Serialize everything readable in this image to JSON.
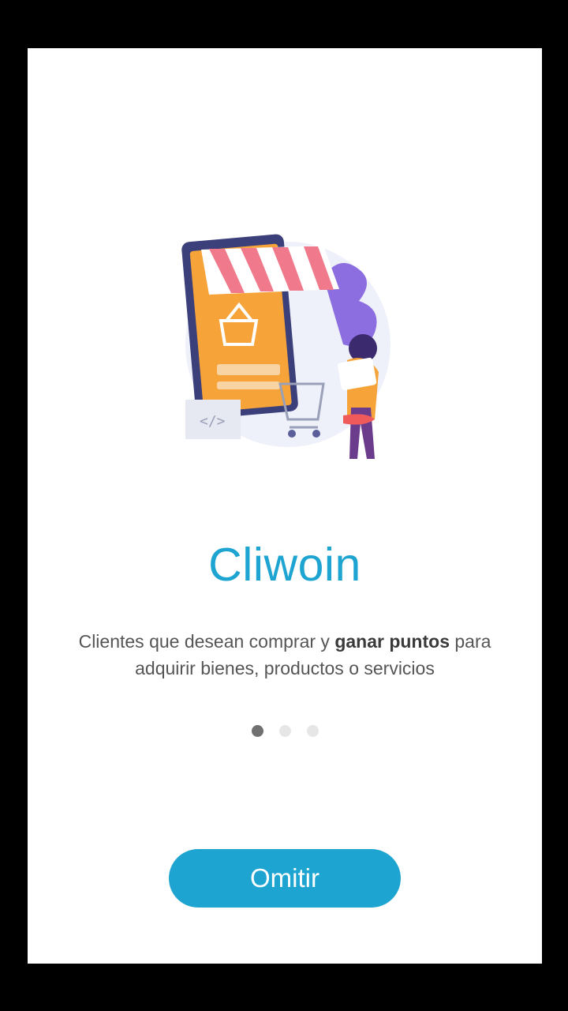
{
  "onboarding": {
    "illustration_icon": "shopping-cart-illustration",
    "title": "Cliwoin",
    "description_part1": "Clientes que desean comprar y ",
    "description_bold": "ganar puntos",
    "description_part2": " para adquirir bienes, productos o servicios",
    "pager": {
      "total": 3,
      "active_index": 0
    },
    "skip_label": "Omitir"
  },
  "colors": {
    "accent": "#1ea4d1",
    "dot_active": "#707070",
    "dot_inactive": "#e6e6e6"
  }
}
